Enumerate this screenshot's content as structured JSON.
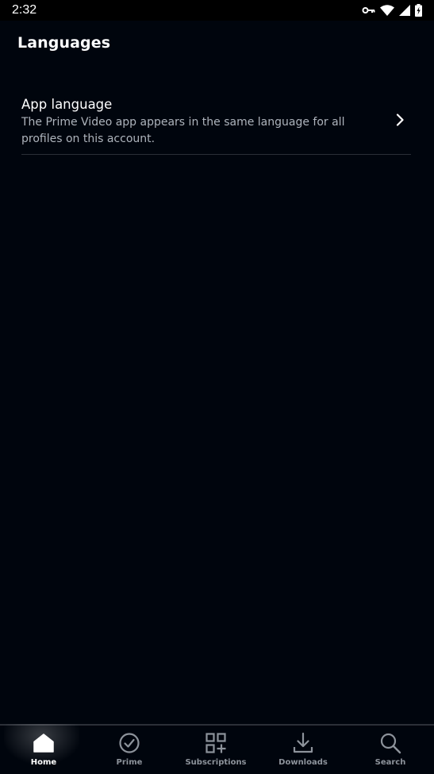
{
  "status_bar": {
    "time": "2:32",
    "icons": [
      "vpn-key-icon",
      "wifi-icon",
      "signal-icon",
      "battery-charging-icon"
    ]
  },
  "page": {
    "title": "Languages"
  },
  "settings": [
    {
      "title": "App language",
      "description": "The Prime Video app appears in the same language for all profiles on this account.",
      "icon": "chevron-right-icon"
    }
  ],
  "bottom_nav": {
    "active": "Home",
    "items": [
      {
        "label": "Home",
        "icon": "home-icon"
      },
      {
        "label": "Prime",
        "icon": "check-circle-icon"
      },
      {
        "label": "Subscriptions",
        "icon": "grid-plus-icon"
      },
      {
        "label": "Downloads",
        "icon": "download-icon"
      },
      {
        "label": "Search",
        "icon": "search-icon"
      }
    ]
  },
  "colors": {
    "background": "#00050d",
    "text_primary": "#ffffff",
    "text_secondary": "#aeb4bc",
    "nav_inactive": "#8d939b"
  }
}
